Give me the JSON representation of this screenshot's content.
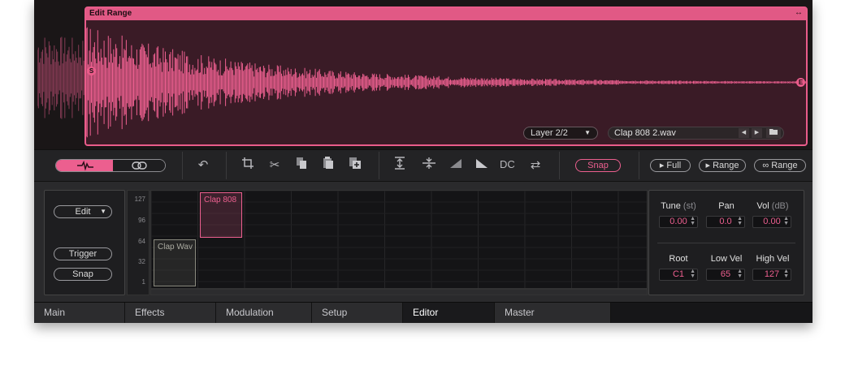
{
  "wave_editor": {
    "edit_range_title": "Edit Range",
    "start_marker": "S",
    "end_marker": "E",
    "layer_select": "Layer 2/2",
    "file_name": "Clap 808 2.wav",
    "wave_color": "#ec5f8f"
  },
  "toolbar": {
    "dc_label": "DC",
    "snap_label": "Snap",
    "play_full_label": "Full",
    "play_range_label": "Range",
    "loop_range_label": "Range"
  },
  "editor": {
    "mode_select": "Edit",
    "trigger_label": "Trigger",
    "snap_label": "Snap",
    "velocity_ticks": [
      "127",
      "96",
      "64",
      "32",
      "1"
    ],
    "zones": [
      {
        "name": "Clap 808",
        "selected": true
      },
      {
        "name": "Clap Wav",
        "selected": false
      }
    ],
    "params": {
      "tune_label": "Tune",
      "tune_unit": "(st)",
      "tune_value": "0.00",
      "pan_label": "Pan",
      "pan_value": "0.0",
      "vol_label": "Vol",
      "vol_unit": "(dB)",
      "vol_value": "0.00",
      "root_label": "Root",
      "root_value": "C1",
      "low_vel_label": "Low Vel",
      "low_vel_value": "65",
      "high_vel_label": "High Vel",
      "high_vel_value": "127"
    }
  },
  "tabs": [
    {
      "label": "Main",
      "active": false
    },
    {
      "label": "Effects",
      "active": false
    },
    {
      "label": "Modulation",
      "active": false
    },
    {
      "label": "Setup",
      "active": false
    },
    {
      "label": "Editor",
      "active": true
    },
    {
      "label": "Master",
      "active": false
    }
  ],
  "accent_color": "#ec5f8f"
}
